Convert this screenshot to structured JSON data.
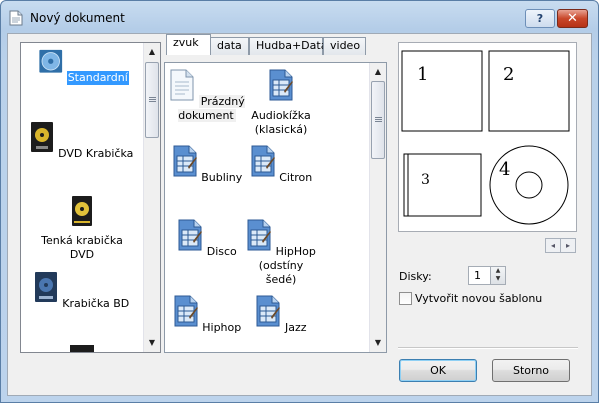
{
  "window": {
    "title": "Nový dokument"
  },
  "titlebar": {
    "help_label": "?",
    "close_label": "✕"
  },
  "left_list": {
    "items": [
      {
        "label": "Standardní",
        "icon": "cd-disc-icon",
        "selected": true
      },
      {
        "label": "DVD Krabička",
        "icon": "dvd-case-icon"
      },
      {
        "label": "Tenká krabička DVD",
        "icon": "slim-dvd-case-icon"
      },
      {
        "label": "Krabička BD",
        "icon": "bd-case-icon"
      }
    ]
  },
  "tabs": [
    {
      "label": "zvuk",
      "active": true
    },
    {
      "label": "data"
    },
    {
      "label": "Hudba+Data"
    },
    {
      "label": "video"
    }
  ],
  "templates": [
    {
      "label": "Prázdný dokument",
      "icon": "blank-document-icon"
    },
    {
      "label": "Audiokížka (klasická)",
      "icon": "template-document-icon"
    },
    {
      "label": "Bubliny",
      "icon": "template-document-icon"
    },
    {
      "label": "Citron",
      "icon": "template-document-icon"
    },
    {
      "label": "Disco",
      "icon": "template-document-icon"
    },
    {
      "label": "HipHop (odstíny šedé)",
      "icon": "template-document-icon"
    },
    {
      "label": "Hiphop",
      "icon": "template-document-icon"
    },
    {
      "label": "Jazz",
      "icon": "template-document-icon"
    }
  ],
  "preview": {
    "labels": [
      "1",
      "2",
      "3",
      "4"
    ]
  },
  "disks": {
    "label": "Disky:",
    "value": "1"
  },
  "new_template": {
    "label": "Vytvořit novou šablonu",
    "checked": false
  },
  "buttons": {
    "ok": "OK",
    "cancel": "Storno"
  },
  "colors": {
    "selection": "#3399ff",
    "title_gradient": "#c8dcf0",
    "close_red": "#c9472a"
  }
}
